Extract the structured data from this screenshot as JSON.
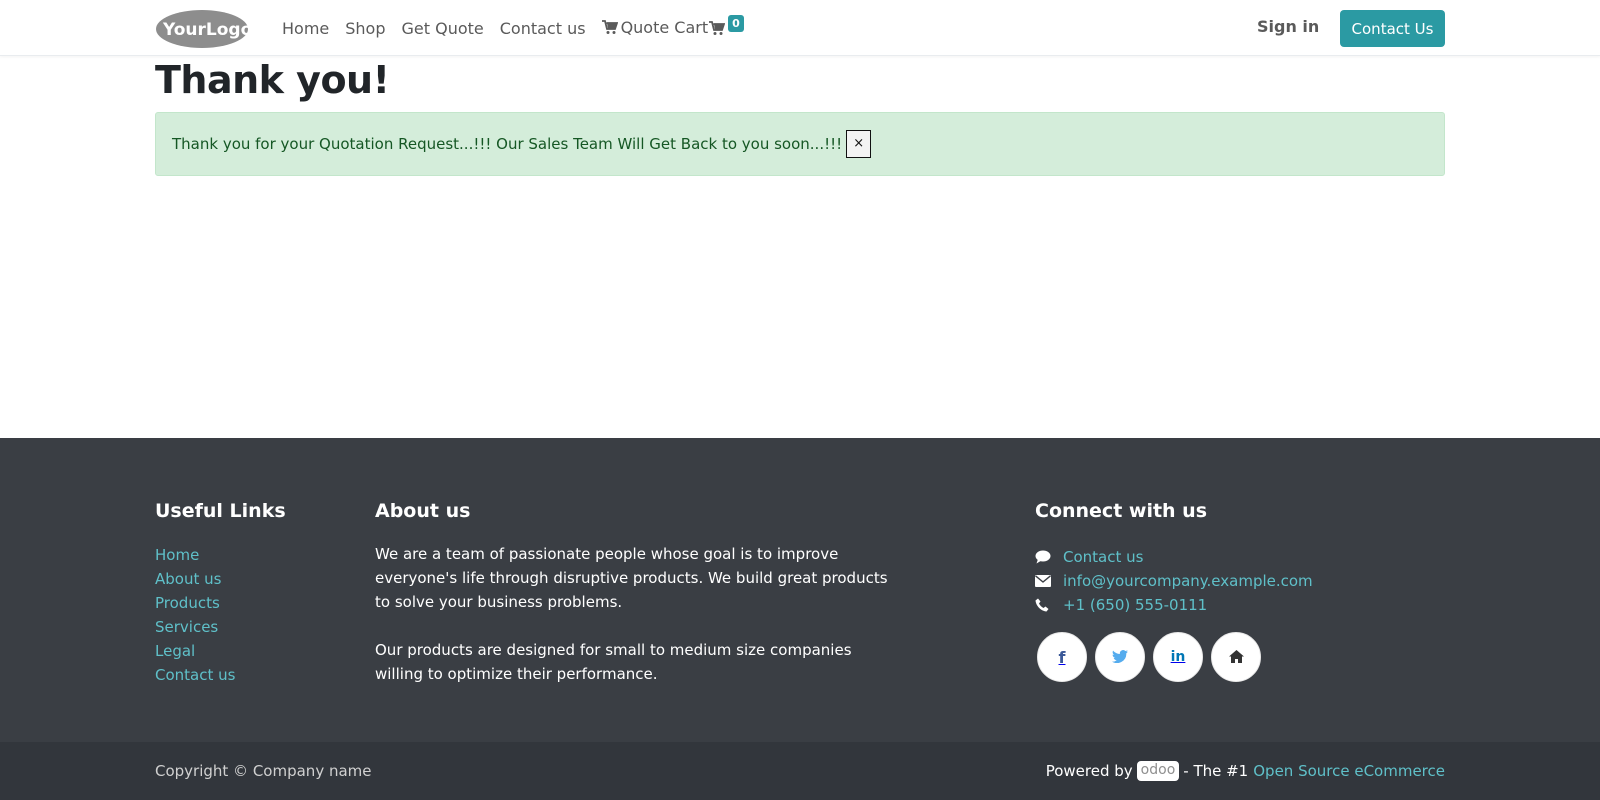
{
  "header": {
    "logo_text": "YourLogo",
    "nav": [
      {
        "label": "Home"
      },
      {
        "label": "Shop"
      },
      {
        "label": "Get Quote"
      },
      {
        "label": "Contact us"
      },
      {
        "label": "Quote Cart",
        "icon": "cart-icon"
      }
    ],
    "cart_count": "0",
    "signin_label": "Sign in",
    "contact_button": "Contact Us"
  },
  "main": {
    "title": "Thank you!",
    "alert_text": "Thank you for your Quotation Request...!!! Our Sales Team Will Get Back to you soon...!!!",
    "alert_close": "×"
  },
  "footer": {
    "useful_links": {
      "heading": "Useful Links",
      "items": [
        "Home",
        "About us",
        "Products",
        "Services",
        "Legal",
        "Contact us"
      ]
    },
    "about": {
      "heading": "About us",
      "p1": "We are a team of passionate people whose goal is to improve everyone's life through disruptive products. We build great products to solve your business problems.",
      "p2": "Our products are designed for small to medium size companies willing to optimize their performance."
    },
    "connect": {
      "heading": "Connect with us",
      "contact_label": "Contact us",
      "email": "info@yourcompany.example.com",
      "phone": "+1 (650) 555-0111",
      "socials": [
        "facebook-icon",
        "twitter-icon",
        "linkedin-icon",
        "home-icon"
      ]
    }
  },
  "copyright": {
    "left": "Copyright © Company name",
    "powered_by": "Powered by",
    "odoo": "odoo",
    "tagline": "- The #1",
    "link": "Open Source eCommerce"
  },
  "colors": {
    "accent": "#2b9aa3",
    "link": "#5fc0c9",
    "footer_bg": "#3a3e44",
    "alert_bg": "#d4edda",
    "alert_text": "#155724"
  }
}
